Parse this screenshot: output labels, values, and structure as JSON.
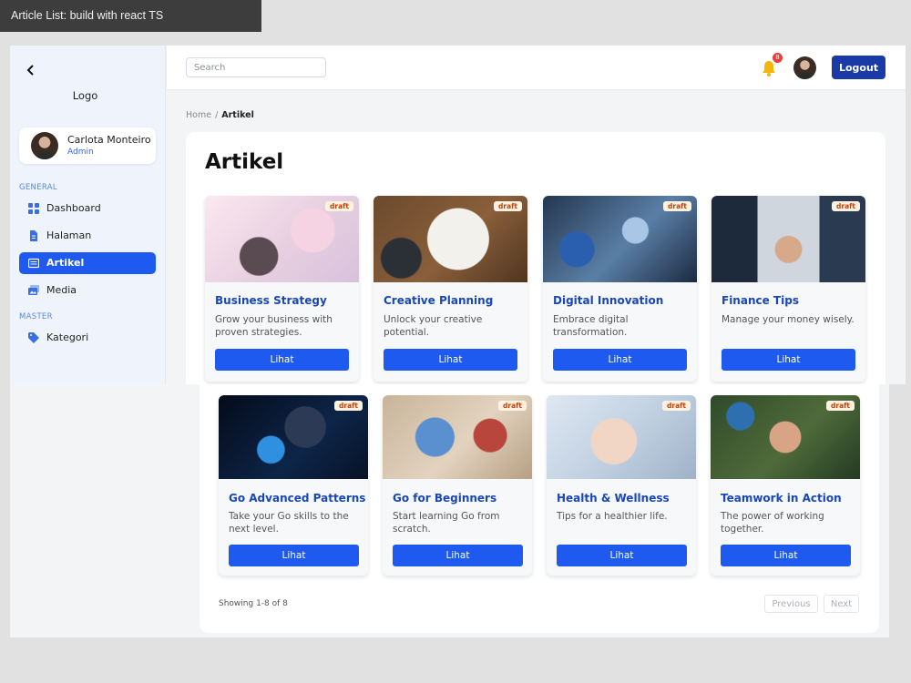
{
  "caption": "Article List: build with react TS",
  "sidebar": {
    "logo": "Logo",
    "user": {
      "name": "Carlota Monteiro",
      "role": "Admin"
    },
    "sections": [
      {
        "label": "GENERAL",
        "items": [
          {
            "label": "Dashboard",
            "icon": "grid-icon"
          },
          {
            "label": "Halaman",
            "icon": "file-icon"
          },
          {
            "label": "Artikel",
            "icon": "article-icon",
            "active": true
          },
          {
            "label": "Media",
            "icon": "media-icon"
          }
        ]
      },
      {
        "label": "MASTER",
        "items": [
          {
            "label": "Kategori",
            "icon": "tag-icon"
          }
        ]
      }
    ]
  },
  "header": {
    "search_placeholder": "Search",
    "notification_count": "8",
    "logout_label": "Logout"
  },
  "breadcrumb": {
    "home": "Home",
    "separator": "/",
    "current": "Artikel"
  },
  "page": {
    "title": "Artikel"
  },
  "articles": [
    {
      "title": "Business Strategy",
      "description": "Grow your business with proven strategies.",
      "status": "draft",
      "button": "Lihat"
    },
    {
      "title": "Creative Planning",
      "description": "Unlock your creative potential.",
      "status": "draft",
      "button": "Lihat"
    },
    {
      "title": "Digital Innovation",
      "description": "Embrace digital transformation.",
      "status": "draft",
      "button": "Lihat"
    },
    {
      "title": "Finance Tips",
      "description": "Manage your money wisely.",
      "status": "draft",
      "button": "Lihat"
    },
    {
      "title": "Go Advanced Patterns",
      "description": "Take your Go skills to the next level.",
      "status": "draft",
      "button": "Lihat"
    },
    {
      "title": "Go for Beginners",
      "description": "Start learning Go from scratch.",
      "status": "draft",
      "button": "Lihat"
    },
    {
      "title": "Health & Wellness",
      "description": "Tips for a healthier life.",
      "status": "draft",
      "button": "Lihat"
    },
    {
      "title": "Teamwork in Action",
      "description": "The power of working together.",
      "status": "draft",
      "button": "Lihat"
    }
  ],
  "pagination": {
    "summary": "Showing 1-8 of 8",
    "previous": "Previous",
    "next": "Next"
  },
  "colors": {
    "primary": "#1f5af0",
    "logout": "#1a3aa8",
    "title_link": "#1947b8",
    "badge_text": "#c2410c",
    "badge_bg": "#fdf1e0",
    "notif": "#ef3b3b"
  }
}
